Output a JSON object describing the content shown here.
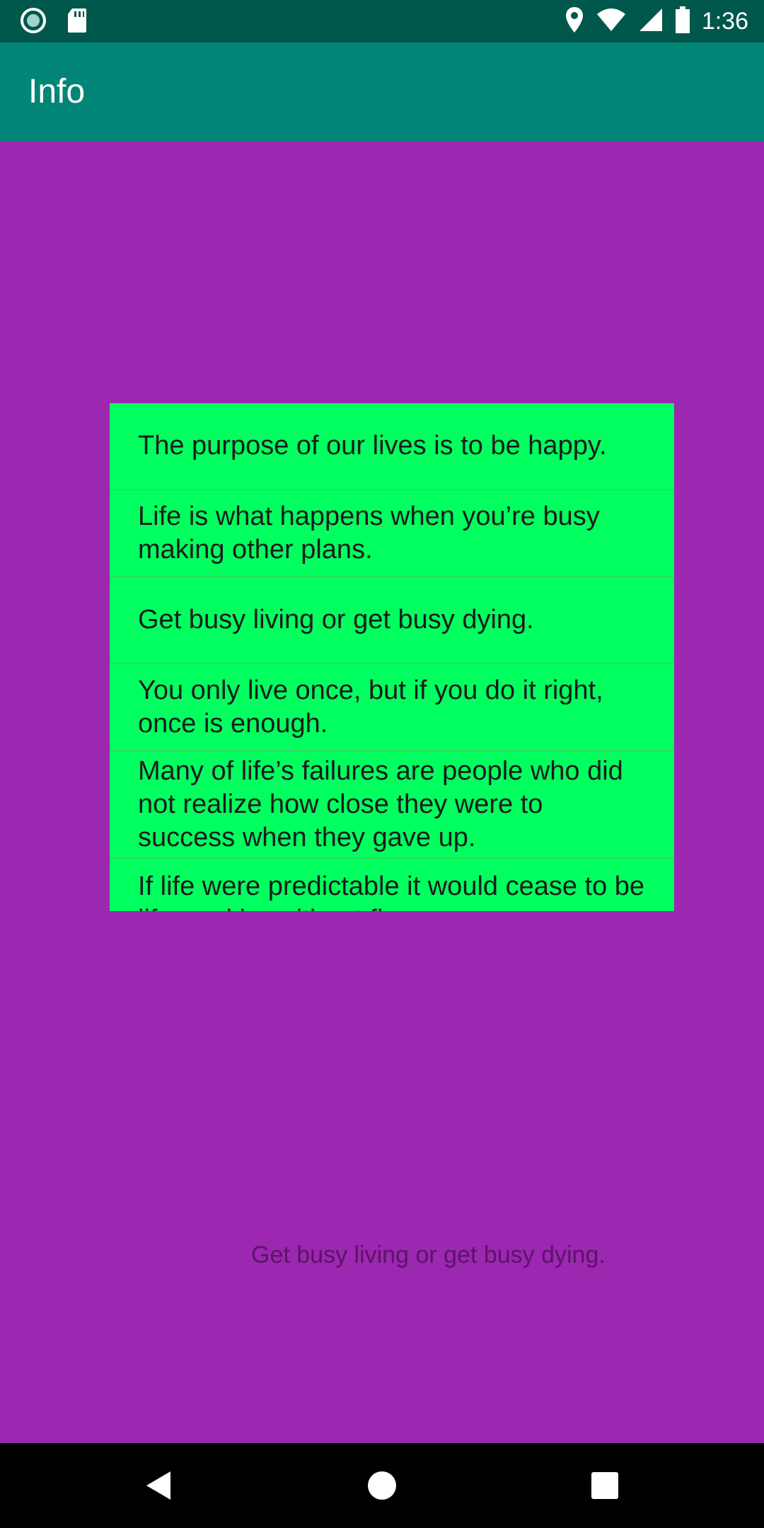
{
  "status_bar": {
    "time": "1:36",
    "icons": [
      "record-icon",
      "sd-card-icon",
      "location-icon",
      "wifi-icon",
      "signal-icon",
      "battery-icon"
    ]
  },
  "app_bar": {
    "title": "Info"
  },
  "quotes": [
    "The purpose of our lives is to be happy.",
    "Life is what happens when you’re busy making other plans.",
    "Get busy living or get busy dying.",
    "You only live once, but if you do it right, once is enough.",
    "Many of life’s failures are people who did not realize how close they were to success when they gave up.",
    "If life were predictable it would cease to be life, and be without flavor."
  ],
  "selected_text": "Get busy living or get busy dying.",
  "nav_bar": {
    "icons": [
      "back-icon",
      "home-icon",
      "recents-icon"
    ]
  },
  "colors": {
    "status_bar": "#00574b",
    "app_bar": "#008577",
    "background": "#9c27b0",
    "list_background": "#00ff5f"
  }
}
